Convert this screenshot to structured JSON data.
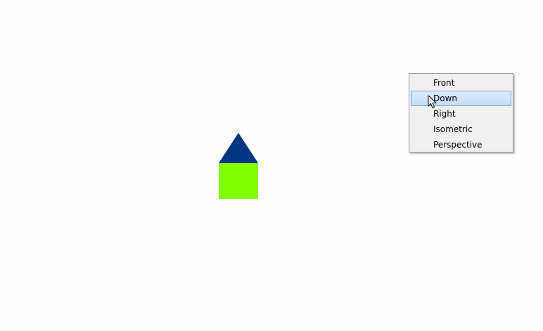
{
  "scene": {
    "roof_color": "#003682",
    "body_color": "#80ff00"
  },
  "context_menu": {
    "items": [
      {
        "label": "Front",
        "highlighted": false
      },
      {
        "label": "Down",
        "highlighted": true
      },
      {
        "label": "Right",
        "highlighted": false
      },
      {
        "label": "Isometric",
        "highlighted": false
      },
      {
        "label": "Perspective",
        "highlighted": false
      }
    ]
  },
  "cursor": {
    "icon": "arrow-pointer-icon"
  }
}
